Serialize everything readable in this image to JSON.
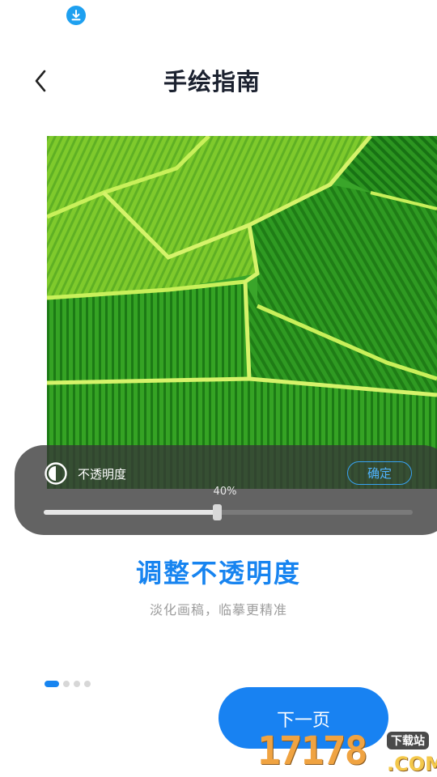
{
  "status_bar": {
    "icon": "download-icon"
  },
  "header": {
    "back_icon": "chevron-left-icon",
    "title": "手绘指南"
  },
  "opacity_panel": {
    "icon": "contrast-icon",
    "label": "不透明度",
    "confirm_label": "确定",
    "slider_value_text": "40%",
    "slider_fraction": 0.47
  },
  "content": {
    "heading": "调整不透明度",
    "subheading": "淡化画稿，临摹更精准"
  },
  "pager": {
    "count": 4,
    "active": 0
  },
  "next_button": {
    "label": "下一页"
  },
  "watermark": {
    "number": "17178",
    "badge": "下载站",
    "suffix": ".COM"
  },
  "colors": {
    "accent": "#1784f0",
    "panel": "#373737",
    "confirm_border": "#38a2f2"
  }
}
